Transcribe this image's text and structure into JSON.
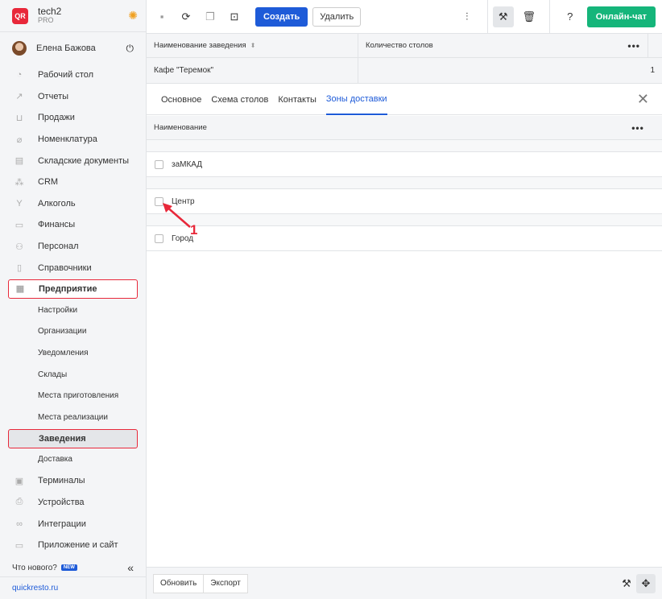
{
  "brand": {
    "logo": "QR",
    "name": "tech2",
    "plan": "PRO",
    "theme_icon": "sun-icon"
  },
  "user": {
    "name": "Елена Бажова"
  },
  "nav": {
    "items": [
      {
        "label": "Рабочий стол",
        "icon": "dashboard-icon"
      },
      {
        "label": "Отчеты",
        "icon": "chart-icon"
      },
      {
        "label": "Продажи",
        "icon": "basket-icon"
      },
      {
        "label": "Номенклатура",
        "icon": "tag-icon"
      },
      {
        "label": "Складские документы",
        "icon": "warehouse-icon"
      },
      {
        "label": "CRM",
        "icon": "crm-icon"
      },
      {
        "label": "Алкоголь",
        "icon": "glass-icon"
      },
      {
        "label": "Финансы",
        "icon": "wallet-icon"
      },
      {
        "label": "Персонал",
        "icon": "people-icon"
      },
      {
        "label": "Справочники",
        "icon": "book-icon"
      }
    ],
    "enterprise": {
      "label": "Предприятие",
      "icon": "building-icon"
    },
    "enterprise_sub": [
      "Настройки",
      "Организации",
      "Уведомления",
      "Склады",
      "Места приготовления",
      "Места реализации"
    ],
    "active_sub": "Заведения",
    "after_active_sub": "Доставка",
    "bottom_items": [
      {
        "label": "Терминалы",
        "icon": "terminal-icon"
      },
      {
        "label": "Устройства",
        "icon": "printer-icon"
      },
      {
        "label": "Интеграции",
        "icon": "link-icon"
      },
      {
        "label": "Приложение и сайт",
        "icon": "app-icon"
      }
    ],
    "whats_new": "Что нового?",
    "new_badge": "NEW",
    "site": "quickresto.ru"
  },
  "toolbar": {
    "create": "Создать",
    "delete": "Удалить",
    "chat": "Онлайн-чат"
  },
  "upper_table": {
    "columns": [
      "Наименование заведения",
      "Количество столов"
    ],
    "rows": [
      {
        "name": "Кафе \"Теремок\"",
        "tables": "1"
      }
    ]
  },
  "tabs": [
    "Основное",
    "Схема столов",
    "Контакты",
    "Зоны доставки"
  ],
  "active_tab": "Зоны доставки",
  "zones": {
    "column": "Наименование",
    "rows": [
      "заМКАД",
      "Центр",
      "Город"
    ]
  },
  "annotation": {
    "number": "1",
    "color": "#e8283a"
  },
  "footer": {
    "refresh": "Обновить",
    "export": "Экспорт"
  },
  "colors": {
    "accent": "#1e5bd8",
    "brand": "#e8283a",
    "chat": "#15b57a"
  }
}
